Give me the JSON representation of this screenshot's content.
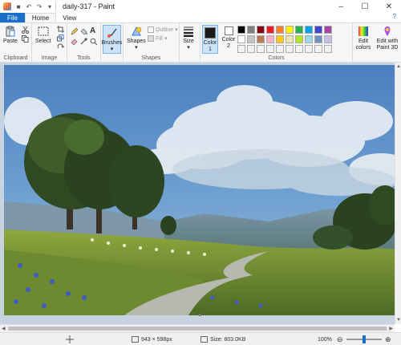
{
  "window": {
    "title": "daily-317 - Paint",
    "controls": [
      "minimize",
      "maximize",
      "close"
    ]
  },
  "quick_access": [
    "save-icon",
    "undo-icon",
    "redo-icon"
  ],
  "tabs": [
    {
      "label": "File"
    },
    {
      "label": "Home"
    },
    {
      "label": "View"
    }
  ],
  "ribbon": {
    "clipboard": {
      "paste": "Paste",
      "group": "Clipboard"
    },
    "image": {
      "select": "Select",
      "group": "Image"
    },
    "tools": {
      "group": "Tools"
    },
    "brushes": {
      "label": "Brushes"
    },
    "shapes": {
      "label": "Shapes",
      "outline": "Outline",
      "fill": "Fill",
      "group": "Shapes"
    },
    "size": {
      "label": "Size"
    },
    "colors": {
      "color1": "Color 1",
      "color2": "Color 2",
      "group": "Colors",
      "edit_colors": "Edit colors",
      "edit_paint3d": "Edit with Paint 3D",
      "color1_value": "#1a1a1a",
      "color2_value": "#ffffff",
      "palette": [
        "#000000",
        "#7f7f7f",
        "#880015",
        "#ed1c24",
        "#ff7f27",
        "#fff200",
        "#22b14c",
        "#00a2e8",
        "#3f48cc",
        "#a349a4",
        "#ffffff",
        "#c3c3c3",
        "#b97a57",
        "#ffaec9",
        "#ffc90e",
        "#efe4b0",
        "#b5e61d",
        "#99d9ea",
        "#7092be",
        "#c8bfe7",
        "#f2f2f2",
        "#f2f2f2",
        "#f2f2f2",
        "#f2f2f2",
        "#f2f2f2",
        "#f2f2f2",
        "#f2f2f2",
        "#f2f2f2",
        "#f2f2f2",
        "#f2f2f2"
      ]
    }
  },
  "status": {
    "dimensions": "943 × 598px",
    "size": "Size: 803.0KB",
    "zoom": "100%",
    "zoom_level": 0.5
  }
}
